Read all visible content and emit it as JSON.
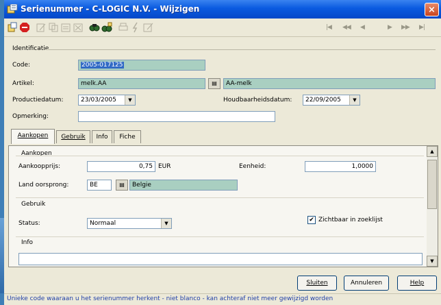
{
  "window": {
    "title": "Serienummer - C-LOGIC N.V. - Wijzigen",
    "close_glyph": "×"
  },
  "toolbar": {
    "icons": [
      "new-icon",
      "stop-icon",
      "edit-icon",
      "copy-icon",
      "delete-icon",
      "search-icon",
      "search-filter-icon",
      "print-icon",
      "flash-icon",
      "note-icon"
    ],
    "navigation": [
      "first-icon",
      "previous-page-icon",
      "previous-icon",
      "next-icon",
      "next-page-icon",
      "last-icon"
    ]
  },
  "identificatie": {
    "group_label": "Identificatie",
    "code_label": "Code:",
    "code_value": "2005-017125",
    "artikel_label": "Artikel:",
    "artikel_value": "melk.AA",
    "artikel_desc": "AA-melk",
    "productiedatum_label": "Productiedatum:",
    "productiedatum_value": "23/03/2005",
    "houdbaarheid_label": "Houdbaarheidsdatum:",
    "houdbaarheid_value": "22/09/2005",
    "opmerking_label": "Opmerking:",
    "opmerking_value": ""
  },
  "tabs": [
    {
      "label": "Aankopen",
      "active": true
    },
    {
      "label": "Gebruik",
      "active": false
    },
    {
      "label": "Info",
      "active": false
    },
    {
      "label": "Fiche",
      "active": false
    }
  ],
  "aankopen": {
    "group_label": "Aankopen",
    "aankoopprijs_label": "Aankoopprijs:",
    "aankoopprijs_value": "0,75",
    "currency": "EUR",
    "eenheid_label": "Eenheid:",
    "eenheid_value": "1,0000",
    "land_label": "Land oorsprong:",
    "land_code": "BE",
    "land_name": "Belgie"
  },
  "gebruik": {
    "group_label": "Gebruik",
    "status_label": "Status:",
    "status_value": "Normaal",
    "zichtbaar_label": "Zichtbaar in zoeklijst",
    "zichtbaar_checked": true
  },
  "info": {
    "group_label": "Info"
  },
  "buttons": {
    "sluiten": "Sluiten",
    "annuleren": "Annuleren",
    "help": "Help"
  },
  "status_bar": {
    "text": "Unieke code waaraan u het serienummer herkent - niet blanco - kan achteraf niet meer gewijzigd worden"
  },
  "colors": {
    "titlebar": "#0a5ae0",
    "readonly_field": "#a9cfc1",
    "selection": "#316ac5",
    "status_text": "#1f3fa8"
  }
}
